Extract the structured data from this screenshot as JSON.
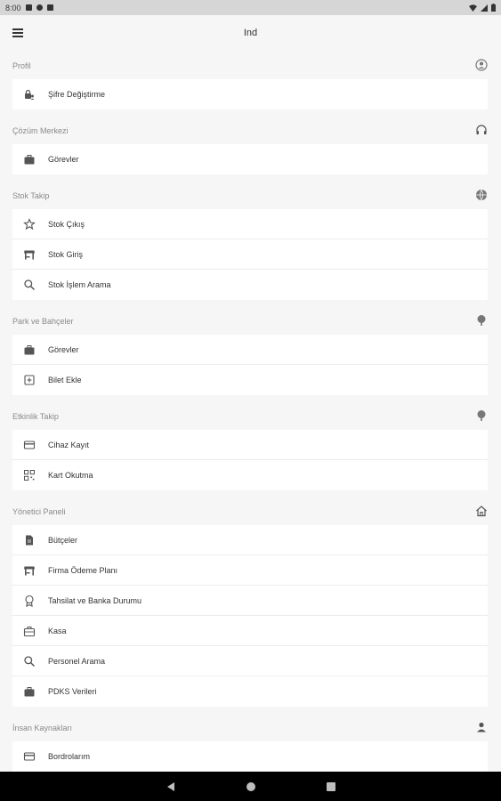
{
  "status_bar": {
    "time": "8:00"
  },
  "app_bar": {
    "title": "Ind"
  },
  "sections": [
    {
      "title": "Profil",
      "header_icon": "account-circle-icon",
      "items": [
        {
          "label": "Şifre Değiştirme",
          "icon": "lock-person-icon"
        }
      ]
    },
    {
      "title": "Çözüm Merkezi",
      "header_icon": "headset-icon",
      "items": [
        {
          "label": "Görevler",
          "icon": "briefcase-icon"
        }
      ]
    },
    {
      "title": "Stok Takip",
      "header_icon": "globe-icon",
      "items": [
        {
          "label": "Stok Çıkış",
          "icon": "star-outline-icon"
        },
        {
          "label": "Stok Giriş",
          "icon": "store-icon"
        },
        {
          "label": "Stok İşlem Arama",
          "icon": "search-icon"
        }
      ]
    },
    {
      "title": "Park ve Bahçeler",
      "header_icon": "tree-icon",
      "items": [
        {
          "label": "Görevler",
          "icon": "briefcase-icon"
        },
        {
          "label": "Bilet Ekle",
          "icon": "add-box-icon"
        }
      ]
    },
    {
      "title": "Etkinlik Takip",
      "header_icon": "tree-icon",
      "items": [
        {
          "label": "Cihaz Kayıt",
          "icon": "credit-card-icon"
        },
        {
          "label": "Kart Okutma",
          "icon": "qr-code-icon"
        }
      ]
    },
    {
      "title": "Yönetici Paneli",
      "header_icon": "home-icon",
      "items": [
        {
          "label": "Bütçeler",
          "icon": "document-icon"
        },
        {
          "label": "Firma Ödeme Planı",
          "icon": "store-icon"
        },
        {
          "label": "Tahsilat ve Banka Durumu",
          "icon": "bank-badge-icon"
        },
        {
          "label": "Kasa",
          "icon": "briefcase-outline-icon"
        },
        {
          "label": "Personel Arama",
          "icon": "search-icon"
        },
        {
          "label": "PDKS Verileri",
          "icon": "briefcase-icon"
        }
      ]
    },
    {
      "title": "İnsan Kaynakları",
      "header_icon": "person-icon",
      "items": [
        {
          "label": "Bordrolarım",
          "icon": "credit-card-icon"
        }
      ]
    }
  ],
  "colors": {
    "background": "#f6f6f6",
    "card": "#ffffff",
    "header_text": "#8a8a8a",
    "icon": "#555555"
  }
}
